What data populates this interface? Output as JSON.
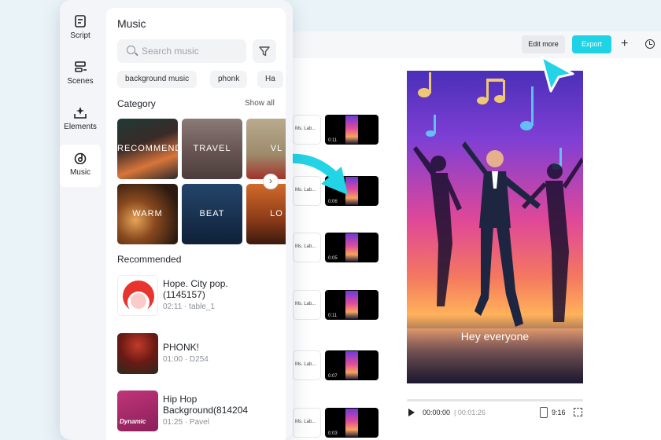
{
  "editor": {
    "edit_more": "Edit more",
    "export": "Export",
    "plus": "+",
    "scenes": [
      {
        "label": "Ms. Lab...",
        "duration": "0:11"
      },
      {
        "label": "Ms. Lab...",
        "duration": "0:06"
      },
      {
        "label": "Ms. Lab...",
        "duration": "0:05"
      },
      {
        "label": "Ms. Lab...",
        "duration": "0:11"
      },
      {
        "label": "Ms. Lab...",
        "duration": "0:07"
      },
      {
        "label": "Ms. Lab...",
        "duration": "0:03"
      }
    ],
    "caption": "Hey everyone",
    "time_current": "00:00:00",
    "time_total": "| 00:01:26",
    "ratio": "9:16"
  },
  "sidebar": {
    "items": [
      {
        "label": "Script",
        "icon": "script-icon"
      },
      {
        "label": "Scenes",
        "icon": "scenes-icon"
      },
      {
        "label": "Elements",
        "icon": "elements-icon"
      },
      {
        "label": "Music",
        "icon": "music-icon"
      }
    ],
    "active": "Music"
  },
  "panel": {
    "title": "Music",
    "search_placeholder": "Search music",
    "chips": [
      "background music",
      "phonk",
      "Ha"
    ],
    "category_heading": "Category",
    "show_all": "Show all",
    "categories": [
      "RECOMMEND",
      "TRAVEL",
      "VL",
      "WARM",
      "BEAT",
      "LO"
    ],
    "recommended_heading": "Recommended",
    "tracks": [
      {
        "title": "Hope. City pop. (1145157)",
        "meta": "02:11 · table_1"
      },
      {
        "title": "PHONK!",
        "meta": "01:00 · D254"
      },
      {
        "title": "Hip Hop Background(814204",
        "meta": "01:25 · Pavel",
        "thumb_text": "Dynamic"
      }
    ]
  },
  "colors": {
    "accent": "#1ed3e5",
    "panel_bg": "#ffffff",
    "sidebar_bg": "#f3f5f8"
  }
}
